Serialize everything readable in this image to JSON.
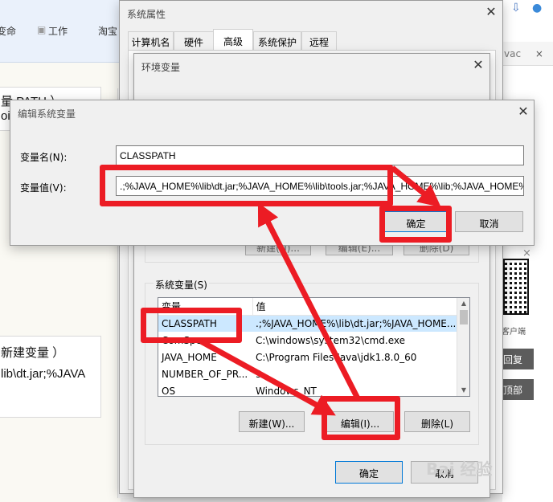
{
  "browser": {
    "bookmarks": [
      "变命",
      "工作",
      "淘宝"
    ],
    "bg_lines": [
      "量 PATH ）",
      "oi",
      "新建变量 ）",
      "lib\\dt.jar;%JAVA"
    ],
    "right_tab": "vac",
    "qr_caption": "客户端",
    "side_buttons": [
      "回复",
      "顶部"
    ],
    "strip_icons": [
      "⇔",
      "×",
      "+"
    ]
  },
  "system_properties": {
    "title": "系统属性",
    "tabs": [
      "计算机名",
      "硬件",
      "高级",
      "系统保护",
      "远程"
    ],
    "active_tab": "高级",
    "ok": "确定",
    "cancel": "取消"
  },
  "env_vars": {
    "title": "环境变量",
    "user_buttons": [
      "新建(N)...",
      "编辑(E)...",
      "删除(D)"
    ],
    "system_vars_label": "系统变量(S)",
    "columns": [
      "变量",
      "值"
    ],
    "rows": [
      {
        "name": "CLASSPATH",
        "value": ".;%JAVA_HOME%\\lib\\dt.jar;%JAVA_HOME..."
      },
      {
        "name": "ComSpec",
        "value": "C:\\windows\\system32\\cmd.exe"
      },
      {
        "name": "JAVA_HOME",
        "value": "C:\\Program Files\\Java\\jdk1.8.0_60"
      },
      {
        "name": "NUMBER_OF_PR...",
        "value": "3"
      },
      {
        "name": "OS",
        "value": "Windows_NT"
      }
    ],
    "new_button": "新建(W)...",
    "edit_button": "编辑(I)...",
    "delete_button": "删除(L)",
    "ok": "确定",
    "cancel": "取消"
  },
  "edit_dialog": {
    "title": "编辑系统变量",
    "name_label": "变量名(N):",
    "name_value": "CLASSPATH",
    "value_label": "变量值(V):",
    "value_value": ".;%JAVA_HOME%\\lib\\dt.jar;%JAVA_HOME%\\lib\\tools.jar;%JAVA_HOME%\\lib;%JAVA_HOME%",
    "ok": "确定",
    "cancel": "取消"
  },
  "watermark": "Bai 经验",
  "colors": {
    "annotation": "#ec1c24",
    "selection": "#cce8ff",
    "window_bg": "#f0f0f0"
  }
}
